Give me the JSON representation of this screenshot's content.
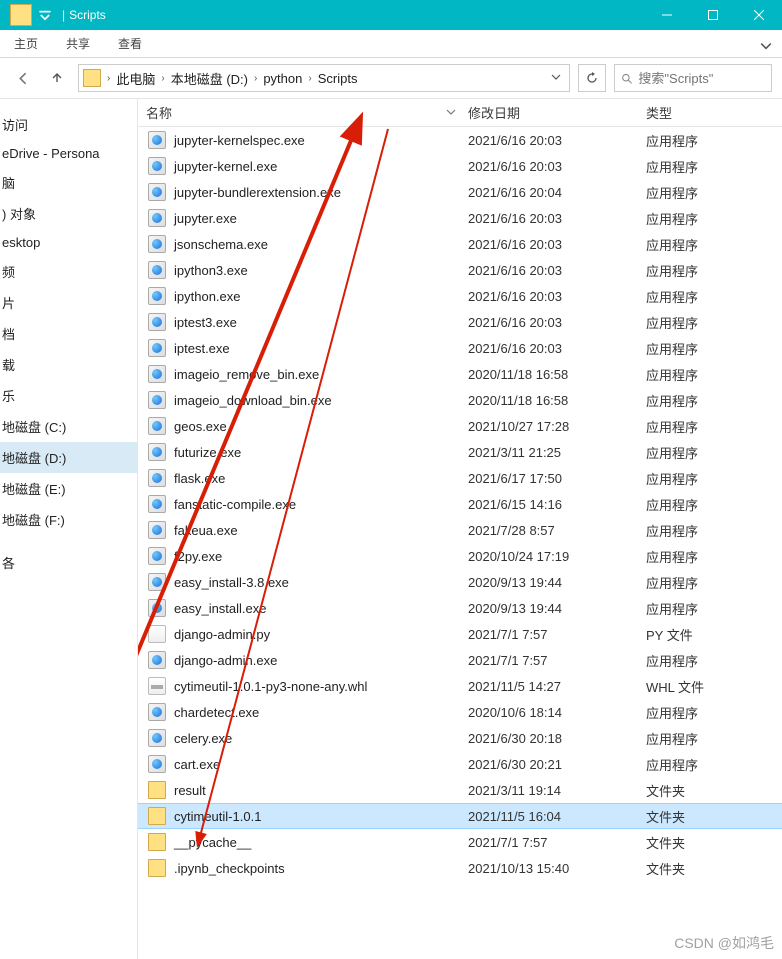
{
  "title": "Scripts",
  "ribbon": {
    "home": "主页",
    "share": "共享",
    "view": "查看"
  },
  "breadcrumb": [
    "此电脑",
    "本地磁盘 (D:)",
    "python",
    "Scripts"
  ],
  "search": {
    "placeholder": "搜索\"Scripts\""
  },
  "sidebar": {
    "items": [
      {
        "label": "访问",
        "partial": true
      },
      {
        "label": "eDrive - Persona",
        "partial": true
      },
      {
        "label": "脑",
        "partial": true
      },
      {
        "label": ") 对象",
        "partial": true
      },
      {
        "label": "esktop",
        "partial": true
      },
      {
        "label": "频",
        "partial": true
      },
      {
        "label": "片",
        "partial": true
      },
      {
        "label": "档",
        "partial": true
      },
      {
        "label": "载",
        "partial": true
      },
      {
        "label": "乐",
        "partial": true
      },
      {
        "label": "地磁盘 (C:)",
        "partial": true
      },
      {
        "label": "地磁盘 (D:)",
        "partial": true,
        "selected": true
      },
      {
        "label": "地磁盘 (E:)",
        "partial": true
      },
      {
        "label": "地磁盘 (F:)",
        "partial": true
      },
      {
        "label": "",
        "partial": false
      },
      {
        "label": "各",
        "partial": true
      }
    ]
  },
  "columns": {
    "name": "名称",
    "date": "修改日期",
    "type": "类型"
  },
  "types": {
    "app": "应用程序",
    "py": "PY 文件",
    "whl": "WHL 文件",
    "folder": "文件夹"
  },
  "files": [
    {
      "icon": "exe",
      "name": "jupyter-kernelspec.exe",
      "date": "2021/6/16 20:03",
      "type": "app"
    },
    {
      "icon": "exe",
      "name": "jupyter-kernel.exe",
      "date": "2021/6/16 20:03",
      "type": "app"
    },
    {
      "icon": "exe",
      "name": "jupyter-bundlerextension.exe",
      "date": "2021/6/16 20:04",
      "type": "app"
    },
    {
      "icon": "exe",
      "name": "jupyter.exe",
      "date": "2021/6/16 20:03",
      "type": "app"
    },
    {
      "icon": "exe",
      "name": "jsonschema.exe",
      "date": "2021/6/16 20:03",
      "type": "app"
    },
    {
      "icon": "exe",
      "name": "ipython3.exe",
      "date": "2021/6/16 20:03",
      "type": "app"
    },
    {
      "icon": "exe",
      "name": "ipython.exe",
      "date": "2021/6/16 20:03",
      "type": "app"
    },
    {
      "icon": "exe",
      "name": "iptest3.exe",
      "date": "2021/6/16 20:03",
      "type": "app"
    },
    {
      "icon": "exe",
      "name": "iptest.exe",
      "date": "2021/6/16 20:03",
      "type": "app"
    },
    {
      "icon": "exe",
      "name": "imageio_remove_bin.exe",
      "date": "2020/11/18 16:58",
      "type": "app"
    },
    {
      "icon": "exe",
      "name": "imageio_download_bin.exe",
      "date": "2020/11/18 16:58",
      "type": "app"
    },
    {
      "icon": "exe",
      "name": "geos.exe",
      "date": "2021/10/27 17:28",
      "type": "app"
    },
    {
      "icon": "exe",
      "name": "futurize.exe",
      "date": "2021/3/11 21:25",
      "type": "app"
    },
    {
      "icon": "exe",
      "name": "flask.exe",
      "date": "2021/6/17 17:50",
      "type": "app"
    },
    {
      "icon": "exe",
      "name": "fanstatic-compile.exe",
      "date": "2021/6/15 14:16",
      "type": "app"
    },
    {
      "icon": "exe",
      "name": "fakeua.exe",
      "date": "2021/7/28 8:57",
      "type": "app"
    },
    {
      "icon": "exe",
      "name": "f2py.exe",
      "date": "2020/10/24 17:19",
      "type": "app"
    },
    {
      "icon": "exe",
      "name": "easy_install-3.8.exe",
      "date": "2020/9/13 19:44",
      "type": "app"
    },
    {
      "icon": "exe",
      "name": "easy_install.exe",
      "date": "2020/9/13 19:44",
      "type": "app"
    },
    {
      "icon": "py",
      "name": "django-admin.py",
      "date": "2021/7/1 7:57",
      "type": "py"
    },
    {
      "icon": "exe",
      "name": "django-admin.exe",
      "date": "2021/7/1 7:57",
      "type": "app"
    },
    {
      "icon": "whl",
      "name": "cytimeutil-1.0.1-py3-none-any.whl",
      "date": "2021/11/5 14:27",
      "type": "whl"
    },
    {
      "icon": "exe",
      "name": "chardetect.exe",
      "date": "2020/10/6 18:14",
      "type": "app"
    },
    {
      "icon": "exe",
      "name": "celery.exe",
      "date": "2021/6/30 20:18",
      "type": "app"
    },
    {
      "icon": "exe",
      "name": "cart.exe",
      "date": "2021/6/30 20:21",
      "type": "app"
    },
    {
      "icon": "folder",
      "name": "result",
      "date": "2021/3/11 19:14",
      "type": "folder"
    },
    {
      "icon": "folder",
      "name": "cytimeutil-1.0.1",
      "date": "2021/11/5 16:04",
      "type": "folder",
      "selected": true
    },
    {
      "icon": "folder",
      "name": "__pycache__",
      "date": "2021/7/1 7:57",
      "type": "folder"
    },
    {
      "icon": "folder",
      "name": ".ipynb_checkpoints",
      "date": "2021/10/13 15:40",
      "type": "folder"
    }
  ],
  "watermark": "CSDN @如鸿毛"
}
